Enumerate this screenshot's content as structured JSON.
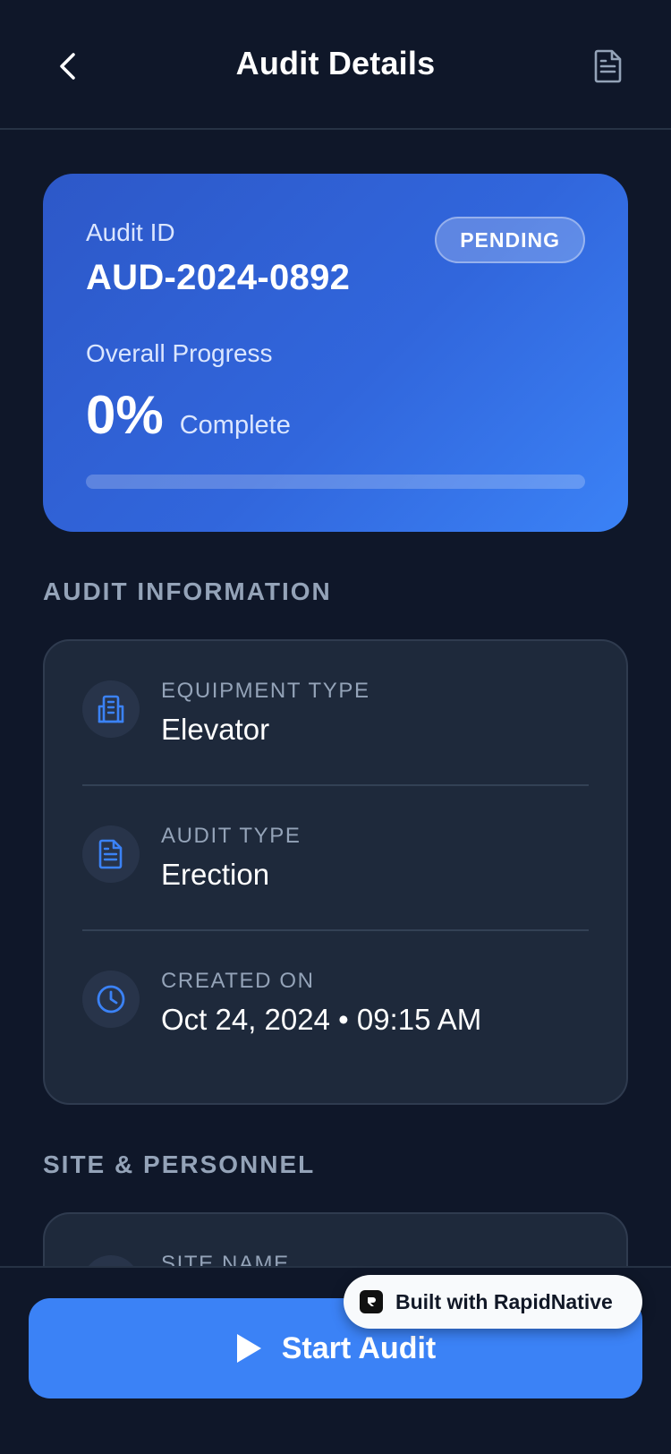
{
  "header": {
    "title": "Audit Details"
  },
  "summary": {
    "audit_id_label": "Audit ID",
    "audit_id": "AUD-2024-0892",
    "status": "PENDING",
    "progress_label": "Overall Progress",
    "progress_percent": "0%",
    "progress_suffix": "Complete",
    "progress_value": 0
  },
  "audit_information": {
    "title": "AUDIT INFORMATION",
    "rows": [
      {
        "label": "EQUIPMENT TYPE",
        "value": "Elevator",
        "icon": "building-icon"
      },
      {
        "label": "AUDIT TYPE",
        "value": "Erection",
        "icon": "document-icon"
      },
      {
        "label": "CREATED ON",
        "value": "Oct 24, 2024 • 09:15 AM",
        "icon": "clock-icon"
      }
    ]
  },
  "site_personnel": {
    "title": "SITE & PERSONNEL",
    "rows": [
      {
        "label": "SITE NAME"
      }
    ]
  },
  "footer": {
    "start_label": "Start Audit",
    "badge_label": "Built with RapidNative"
  },
  "colors": {
    "background": "#0f1729",
    "card": "#1e293b",
    "accent": "#3b82f6",
    "muted_text": "#94a3b8"
  }
}
